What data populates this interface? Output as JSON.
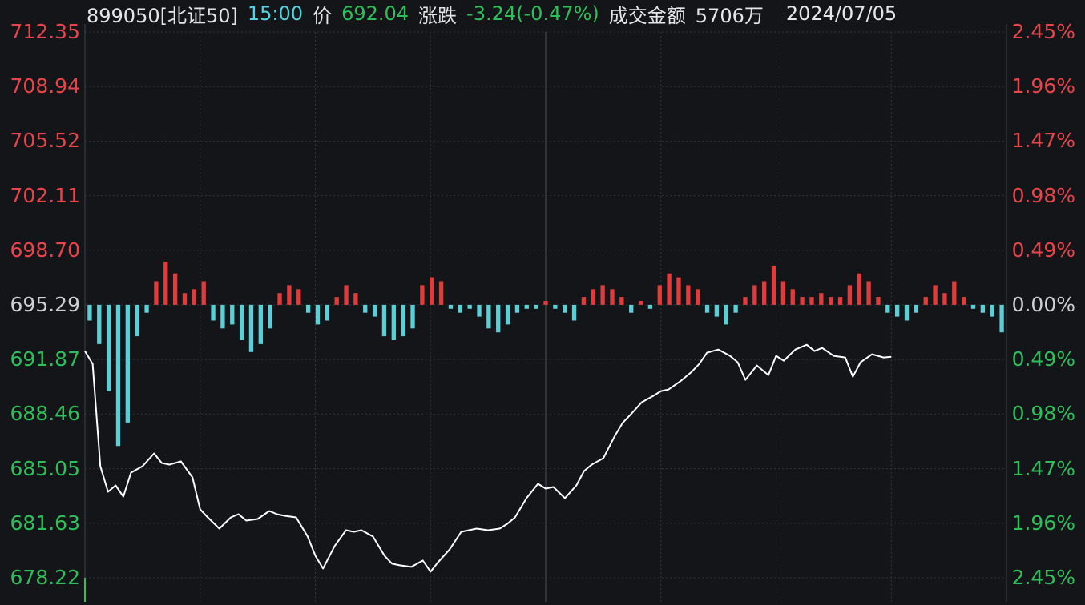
{
  "header": {
    "code": "899050[北证50]",
    "time": "15:00",
    "price_label": "价",
    "price": "692.04",
    "change_label": "涨跌",
    "change": "-3.24(-0.47%)",
    "amount_label": "成交金额",
    "amount": "5706万",
    "date": "2024/07/05"
  },
  "colors": {
    "background": "#131519",
    "grid": "#2e3540",
    "up": "#e03c3c",
    "down": "#5ad0d6",
    "line": "#ffffff",
    "label_up": "#e8454a",
    "label_down": "#2fbf5a",
    "label_base": "#d0d0d0"
  },
  "chart_data": {
    "type": "line",
    "base_price": 695.29,
    "ylim": [
      678.22,
      712.35
    ],
    "left_ticks": [
      "712.35",
      "708.94",
      "705.52",
      "702.11",
      "698.70",
      "695.29",
      "691.87",
      "688.46",
      "685.05",
      "681.63",
      "678.22"
    ],
    "right_ticks": [
      "2.45%",
      "1.96%",
      "1.47%",
      "0.98%",
      "0.49%",
      "0.00%",
      "0.49%",
      "0.98%",
      "1.47%",
      "1.96%",
      "2.45%"
    ],
    "price_series": {
      "x": [
        0,
        2,
        4,
        6,
        8,
        10,
        12,
        15,
        18,
        20,
        22,
        25,
        28,
        30,
        32,
        35,
        38,
        40,
        42,
        45,
        48,
        50,
        52,
        55,
        58,
        60,
        62,
        65,
        68,
        70,
        72,
        75,
        78,
        80,
        82,
        85,
        88,
        90,
        92,
        95,
        98,
        100,
        102,
        105,
        108,
        110,
        112,
        115,
        118,
        120,
        122,
        125,
        128,
        130,
        132,
        135,
        138,
        140,
        142,
        145,
        148,
        150,
        152,
        155,
        158,
        160,
        162,
        165,
        168,
        170,
        172,
        175,
        178,
        180,
        182,
        185,
        188,
        190,
        192,
        195,
        198,
        200,
        202,
        205,
        208,
        210,
        212,
        215,
        218,
        220,
        222,
        225,
        228,
        230,
        232,
        235,
        238,
        240
      ],
      "values": [
        692.4,
        691.6,
        685.2,
        683.6,
        684.0,
        683.3,
        684.8,
        685.2,
        686.0,
        685.4,
        685.3,
        685.5,
        684.5,
        682.5,
        682.0,
        681.3,
        682.0,
        682.2,
        681.8,
        681.9,
        682.4,
        682.2,
        682.1,
        682.0,
        680.8,
        679.6,
        678.8,
        680.2,
        681.2,
        681.1,
        681.2,
        680.8,
        679.6,
        679.1,
        679.0,
        678.9,
        679.3,
        678.6,
        679.2,
        680.0,
        681.1,
        681.2,
        681.3,
        681.2,
        681.3,
        681.6,
        682.0,
        683.2,
        684.1,
        683.8,
        683.9,
        683.2,
        684.0,
        684.9,
        685.3,
        685.7,
        687.1,
        687.9,
        688.4,
        689.2,
        689.6,
        689.9,
        690.0,
        690.5,
        691.1,
        691.6,
        692.3,
        692.5,
        692.1,
        691.7,
        690.6,
        691.5,
        690.9,
        692.1,
        691.8,
        692.5,
        692.8,
        692.4,
        692.6,
        692.1,
        692.0,
        690.8,
        691.7,
        692.2,
        692.0,
        692.04
      ],
      "x_note": "",
      "name": ""
    },
    "volume_bars": [
      {
        "v": -4
      },
      {
        "v": -10
      },
      {
        "v": -22
      },
      {
        "v": -36
      },
      {
        "v": -30
      },
      {
        "v": -8
      },
      {
        "v": -2
      },
      {
        "v": 6
      },
      {
        "v": 11
      },
      {
        "v": 8
      },
      {
        "v": 3
      },
      {
        "v": 4
      },
      {
        "v": 6
      },
      {
        "v": -4
      },
      {
        "v": -6
      },
      {
        "v": -5
      },
      {
        "v": -9
      },
      {
        "v": -12
      },
      {
        "v": -10
      },
      {
        "v": -6
      },
      {
        "v": 3
      },
      {
        "v": 5
      },
      {
        "v": 4
      },
      {
        "v": -2
      },
      {
        "v": -5
      },
      {
        "v": -4
      },
      {
        "v": 2
      },
      {
        "v": 5
      },
      {
        "v": 3
      },
      {
        "v": -2
      },
      {
        "v": -3
      },
      {
        "v": -8
      },
      {
        "v": -9
      },
      {
        "v": -8
      },
      {
        "v": -6
      },
      {
        "v": 5
      },
      {
        "v": 7
      },
      {
        "v": 6
      },
      {
        "v": -1
      },
      {
        "v": -2
      },
      {
        "v": -1
      },
      {
        "v": -3
      },
      {
        "v": -6
      },
      {
        "v": -7
      },
      {
        "v": -5
      },
      {
        "v": -2
      },
      {
        "v": -1
      },
      {
        "v": -1
      },
      {
        "v": 1
      },
      {
        "v": -1
      },
      {
        "v": -2
      },
      {
        "v": -4
      },
      {
        "v": 2
      },
      {
        "v": 4
      },
      {
        "v": 5
      },
      {
        "v": 4
      },
      {
        "v": 2
      },
      {
        "v": -2
      },
      {
        "v": 1
      },
      {
        "v": -1
      },
      {
        "v": 5
      },
      {
        "v": 8
      },
      {
        "v": 7
      },
      {
        "v": 5
      },
      {
        "v": 4
      },
      {
        "v": -2
      },
      {
        "v": -3
      },
      {
        "v": -5
      },
      {
        "v": -2
      },
      {
        "v": 2
      },
      {
        "v": 5
      },
      {
        "v": 6
      },
      {
        "v": 10
      },
      {
        "v": 6
      },
      {
        "v": 4
      },
      {
        "v": 2
      },
      {
        "v": 2
      },
      {
        "v": 3
      },
      {
        "v": 2
      },
      {
        "v": 2
      },
      {
        "v": 5
      },
      {
        "v": 8
      },
      {
        "v": 6
      },
      {
        "v": 2
      },
      {
        "v": -2
      },
      {
        "v": -3
      },
      {
        "v": -4
      },
      {
        "v": -2
      },
      {
        "v": 2
      },
      {
        "v": 5
      },
      {
        "v": 3
      },
      {
        "v": 6
      },
      {
        "v": 2
      },
      {
        "v": -1
      },
      {
        "v": -2
      },
      {
        "v": -3
      },
      {
        "v": -7
      }
    ]
  }
}
